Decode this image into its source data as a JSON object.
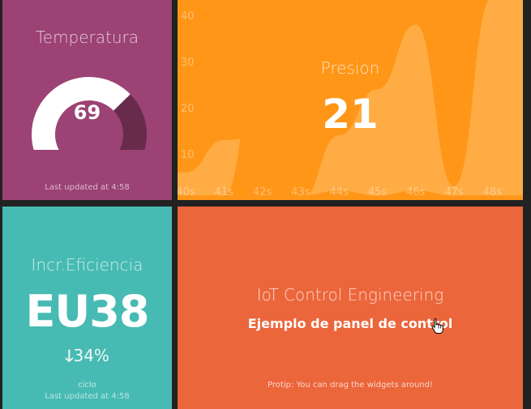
{
  "temperature": {
    "title": "Temperatura",
    "value": "69",
    "gauge_fraction": 0.69,
    "updated": "Last updated at 4:58",
    "colors": {
      "bg": "#9c4274",
      "fill": "#ffffff",
      "rest": "#692b4c"
    }
  },
  "pressure": {
    "title": "Presion",
    "value": "21",
    "colors": {
      "bg": "#ff9618",
      "back": "#ffac44",
      "front": "#ff9618"
    },
    "chart_data": {
      "type": "area",
      "x": [
        "40s",
        "41s",
        "42s",
        "43s",
        "44s",
        "45s",
        "46s",
        "47s",
        "48s"
      ],
      "y_ticks": [
        10,
        20,
        30,
        40
      ],
      "ylim": [
        0,
        43
      ],
      "series": [
        {
          "values": [
            6,
            13,
            14,
            0,
            14,
            24,
            38,
            3,
            44
          ]
        },
        {
          "values": [
            1,
            1,
            36,
            1,
            2,
            1,
            2,
            1,
            1
          ]
        }
      ]
    }
  },
  "efficiency": {
    "title": "Incr.Eficiencia",
    "value": "EU38",
    "change_arrow": "🡓",
    "change": "34%",
    "more_info": "ciclo",
    "updated": "Last updated at 4:58",
    "colors": {
      "bg": "#47bbb3"
    }
  },
  "info": {
    "title": "IoT Control Engineering",
    "subtitle": "Ejemplo de panel de control",
    "protip": "Protip: You can drag the widgets around!",
    "colors": {
      "bg": "#ec663c"
    }
  }
}
